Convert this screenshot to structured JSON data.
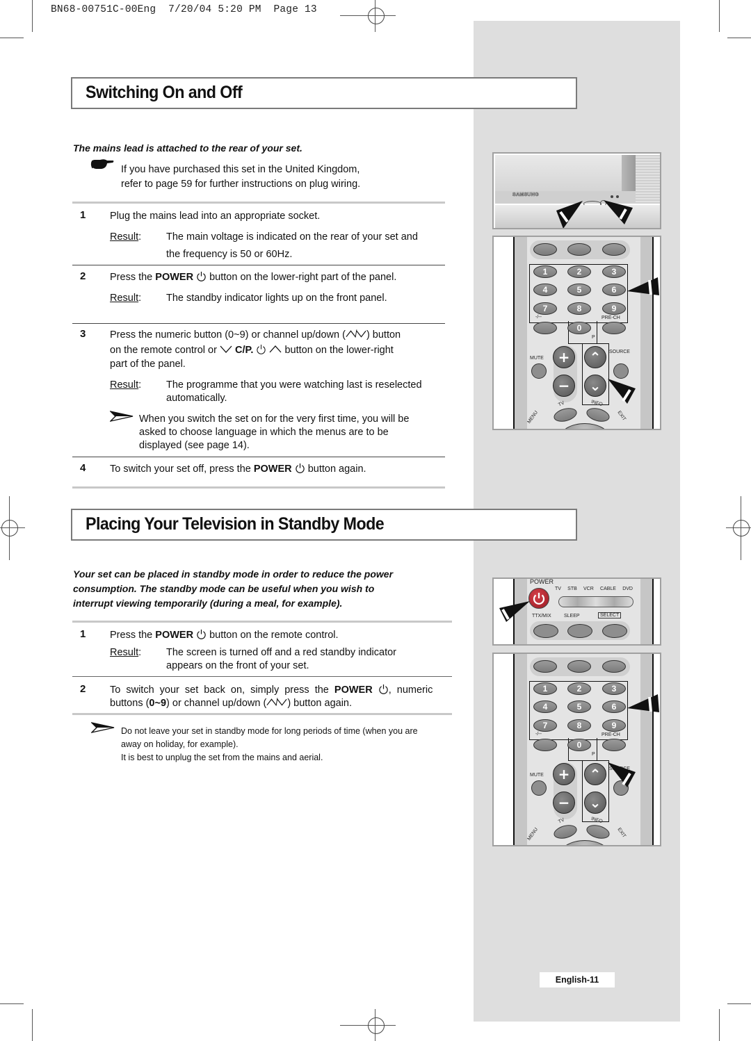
{
  "slug": {
    "code": "BN68-00751C-00Eng",
    "date": "7/20/04",
    "time": "5:20 PM",
    "page_label": "Page 13"
  },
  "section1": {
    "title": "Switching On and Off",
    "lead": "The mains lead is attached to the rear of your set.",
    "note_icon": "pointing-hand-icon",
    "note_line1": "If you have purchased this set in the United Kingdom,",
    "note_line2": "refer to page 59 for further instructions on plug wiring.",
    "steps": [
      {
        "number": "1",
        "text": "Plug the mains lead into an appropriate socket.",
        "result_label": "Result",
        "result_line1": "The main voltage is indicated on the rear of your set and",
        "result_line2": "the frequency is 50 or 60Hz."
      },
      {
        "number": "2",
        "text_pre": "Press the ",
        "text_bold": "POWER",
        "text_post": " button on the lower-right part of the panel.",
        "result_label": "Result",
        "result_line1": "The standby indicator lights up on the front panel."
      },
      {
        "number": "3",
        "line1_pre": "Press the numeric button (0~9) or channel up/down (",
        "line1_post": ") button",
        "line2_pre": "on the remote control or ",
        "line2_bold": "C/P.",
        "line2_post": " button on the lower-right",
        "line3": "part of the panel.",
        "result_label": "Result",
        "result_line1": "The programme that you were watching last is reselected",
        "result_line2": "automatically.",
        "note_icon": "arrow-note-icon",
        "note_line1": "When you switch the set on for the very first time, you will be",
        "note_line2": "asked to choose language in which the menus are to be",
        "note_line3": "displayed (see page 14)."
      },
      {
        "number": "4",
        "text_pre": "To switch your set off, press the ",
        "text_bold": "POWER",
        "text_post": " button again."
      }
    ]
  },
  "section2": {
    "title": "Placing Your Television in Standby Mode",
    "lead_line1": "Your set can be placed in standby mode in order to reduce the power",
    "lead_line2": "consumption. The standby mode can be useful when you wish to",
    "lead_line3": "interrupt viewing temporarily (during a meal, for example).",
    "steps": [
      {
        "number": "1",
        "text_pre": "Press the ",
        "text_bold": "POWER",
        "text_post": " button on the remote control.",
        "result_label": "Result",
        "result_line1": "The screen is turned off and a red standby indicator",
        "result_line2": "appears on the front of your set."
      },
      {
        "number": "2",
        "line1_pre": "To switch your set back on, simply press the ",
        "line1_bold": "POWER",
        "line1_post": ", numeric",
        "line2_pre": "buttons (",
        "line2_bold": "0~9",
        "line2_mid": ") or channel up/down (",
        "line2_post": ") button again."
      }
    ],
    "note_icon": "arrow-note-icon",
    "note_line1": "Do not leave your set in standby mode for long periods of time (when you are",
    "note_line2": "away on holiday, for example).",
    "note_line3": "It is best to unplug the set from the mains and aerial."
  },
  "figures": {
    "tv_brand": "SAMSUNG",
    "remote": {
      "keys": [
        "1",
        "2",
        "3",
        "4",
        "5",
        "6",
        "7",
        "8",
        "9",
        "0"
      ],
      "dash_label": "-/--",
      "prech_label": "PRE-CH",
      "p_label": "P",
      "mute_label": "MUTE",
      "source_label": "SOURCE",
      "tv_label": "TV",
      "info_label": "INFO",
      "menu_label": "MENU",
      "exit_label": "EXIT"
    },
    "remote_top": {
      "power_label": "POWER",
      "modes": [
        "TV",
        "STB",
        "VCR",
        "CABLE",
        "DVD"
      ],
      "ttx_label": "TTX/MIX",
      "sleep_label": "SLEEP",
      "select_label": "SELECT"
    }
  },
  "footer": {
    "page_number": "English-11"
  },
  "colors": {
    "sidebar": "#dedede",
    "power_button": "#b0202a",
    "title_border": "#7a7a7a"
  }
}
